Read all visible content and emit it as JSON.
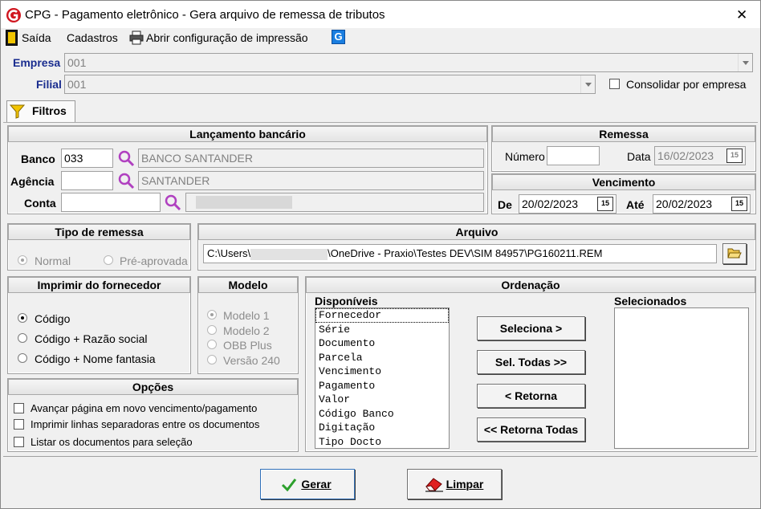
{
  "window": {
    "title": "CPG -  Pagamento eletrônico - Gera arquivo de remessa de tributos",
    "close": "✕"
  },
  "menu": {
    "saida": "Saída",
    "cadastros": "Cadastros",
    "abrir_config": "Abrir configuração de impressão"
  },
  "empresa": {
    "label": "Empresa",
    "value": "001"
  },
  "filial": {
    "label": "Filial",
    "value": "001",
    "consolidar": "Consolidar por empresa",
    "consolidar_checked": false
  },
  "tab": {
    "label": "Filtros"
  },
  "lancamento": {
    "title": "Lançamento bancário",
    "banco_label": "Banco",
    "banco_code": "033",
    "banco_name": "BANCO SANTANDER",
    "agencia_label": "Agência",
    "agencia_code": "",
    "agencia_name": "SANTANDER",
    "conta_label": "Conta",
    "conta_code": "",
    "conta_name": ""
  },
  "remessa": {
    "title": "Remessa",
    "numero_label": "Número",
    "numero_value": "",
    "data_label": "Data",
    "data_value": "16/02/2023"
  },
  "vencimento": {
    "title": "Vencimento",
    "de_label": "De",
    "de_value": "20/02/2023",
    "ate_label": "Até",
    "ate_value": "20/02/2023"
  },
  "tipo_remessa": {
    "title": "Tipo de remessa",
    "normal": "Normal",
    "pre_aprovada": "Pré-aprovada",
    "selected": "normal"
  },
  "arquivo": {
    "title": "Arquivo",
    "path_a": "C:\\Users\\",
    "path_b": "\\OneDrive - Praxio\\Testes DEV\\SIM 84957\\PG160211.REM"
  },
  "imprimir": {
    "title": "Imprimir do fornecedor",
    "options": [
      "Código",
      "Código + Razão social",
      "Código + Nome fantasia"
    ],
    "selected": 0
  },
  "modelo": {
    "title": "Modelo",
    "options": [
      "Modelo 1",
      "Modelo 2",
      "OBB Plus",
      "Versão 240"
    ],
    "selected": 0
  },
  "opcoes": {
    "title": "Opções",
    "items": [
      "Avançar página em novo vencimento/pagamento",
      "Imprimir linhas separadoras entre os documentos",
      "Listar os documentos para seleção"
    ]
  },
  "ordenacao": {
    "title": "Ordenação",
    "disponiveis_label": "Disponíveis",
    "selecionados_label": "Selecionados",
    "disponiveis": [
      "Fornecedor",
      "Série",
      "Documento",
      "Parcela",
      "Vencimento",
      "Pagamento",
      "Valor",
      "Código Banco",
      "Digitação",
      "Tipo Docto"
    ],
    "selecionados": [],
    "btn_seleciona": "Seleciona >",
    "btn_sel_todas": "Sel. Todas >>",
    "btn_retorna": "< Retorna",
    "btn_retorna_todas": "<< Retorna Todas"
  },
  "footer": {
    "gerar": "Gerar",
    "limpar": "Limpar"
  },
  "colors": {
    "label_blue": "#1a2d8f",
    "search_purple": "#b040c0",
    "accent": "#0078d7"
  }
}
